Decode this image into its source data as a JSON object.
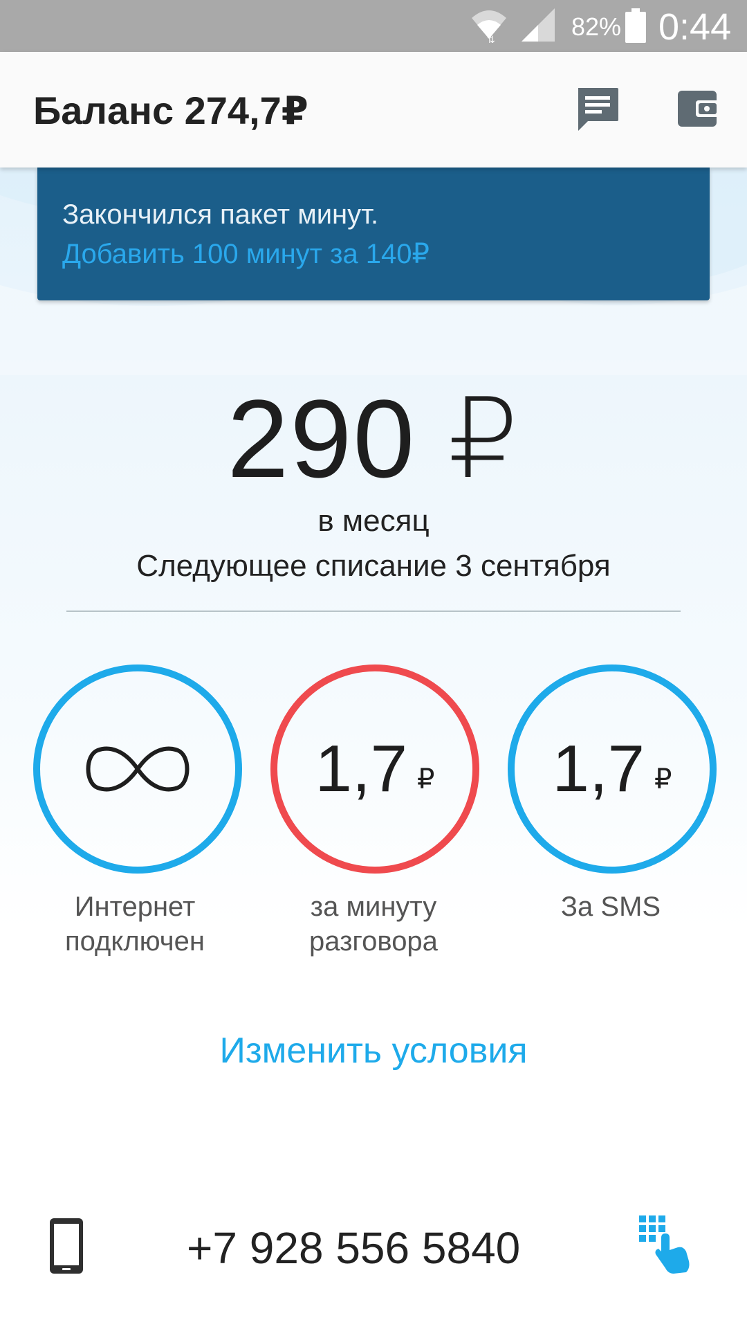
{
  "status_bar": {
    "battery_percent": "82%",
    "time": "0:44",
    "icons": [
      "wifi-icon",
      "signal-icon",
      "battery-icon"
    ]
  },
  "header": {
    "balance": "Баланс 274,7₽",
    "actions": [
      "chat-icon",
      "wallet-icon"
    ]
  },
  "banner": {
    "message": "Закончился пакет минут.",
    "action_link": "Добавить 100 минут за 140₽"
  },
  "tariff": {
    "price": "290 ₽",
    "period": "в месяц",
    "next_charge": "Следующее списание 3 сентября"
  },
  "features": [
    {
      "icon": "infinity-icon",
      "value": "",
      "currency": "",
      "label": "Интернет подключен",
      "status_color": "#1eaaea"
    },
    {
      "icon": "",
      "value": "1,7",
      "currency": "₽",
      "label": "за минуту разговора",
      "status_color": "#ef4a4e"
    },
    {
      "icon": "",
      "value": "1,7",
      "currency": "₽",
      "label": "За SMS",
      "status_color": "#1eaaea"
    }
  ],
  "change_terms": "Изменить условия",
  "footer": {
    "phone_number": "+7 928 556 5840",
    "icons": [
      "phone-icon",
      "dialpad-icon"
    ]
  },
  "colors": {
    "accent": "#1eaaea",
    "warning": "#ef4a4e",
    "banner_bg": "#1b5e8a"
  }
}
